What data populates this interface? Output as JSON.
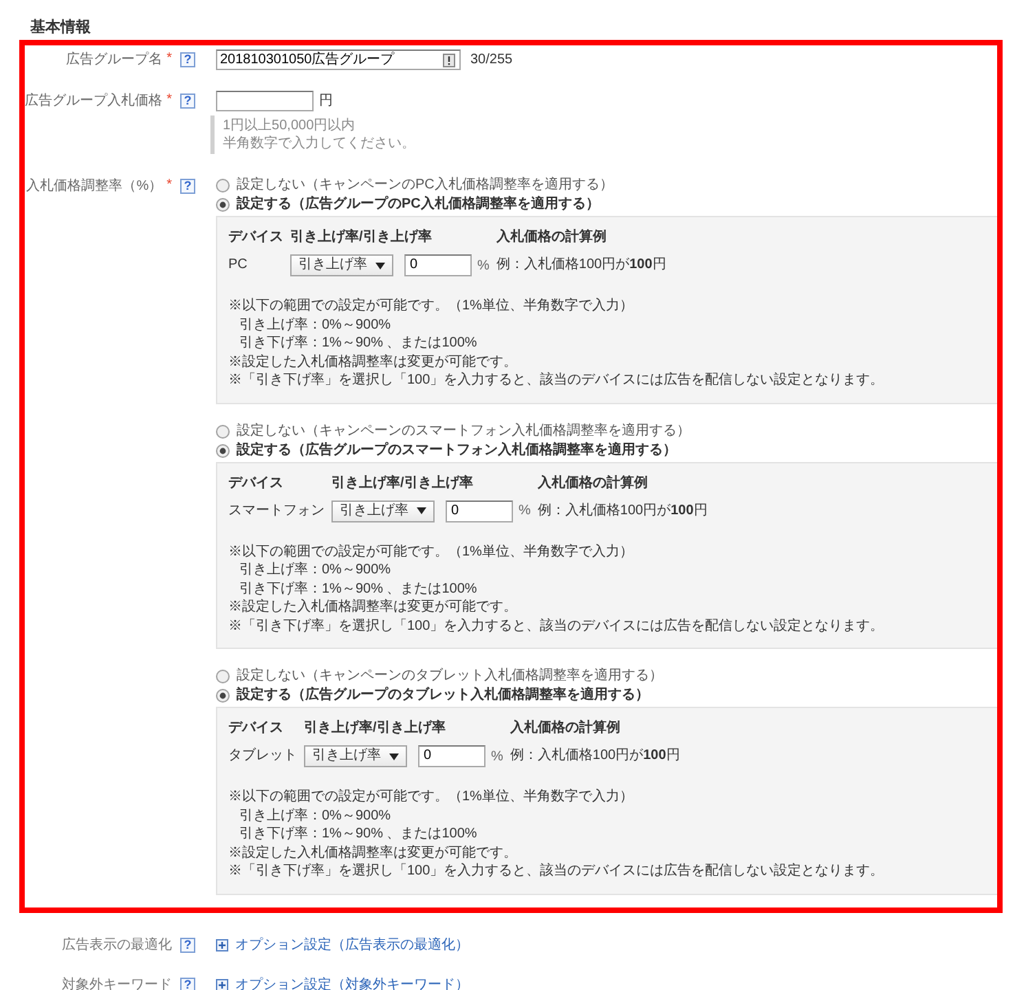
{
  "heading": "基本情報",
  "fields": [
    {
      "kind": "text",
      "highlighted": true,
      "label": "広告グループ名",
      "required_mark": "*",
      "help": "?",
      "value": "201810301050広告グループ",
      "counter": "30/255"
    },
    {
      "kind": "price",
      "highlighted": true,
      "label": "広告グループ入札価格",
      "required_mark": "*",
      "help": "?",
      "unit": "円",
      "hints": [
        "1円以上50,000円以内",
        "半角数字で入力してください。"
      ]
    },
    {
      "kind": "adjustment",
      "highlighted": true,
      "label": "入札価格調整率（%）",
      "required_mark": "*",
      "help": "?",
      "devices": [
        {
          "options": [
            {
              "label": "設定しない（キャンペーンのPC入札価格調整率を適用する）",
              "selected": false
            },
            {
              "label": "設定する（広告グループのPC入札価格調整率を適用する）",
              "selected": true
            }
          ],
          "headers": [
            "デバイス",
            "引き上げ率/引き上げ率",
            "入札価格の計算例"
          ],
          "device": "PC",
          "direction": "引き上げ率",
          "rate": "0",
          "unit": "%",
          "example": "例：入札価格100円が**100**円",
          "notes": [
            {
              "text": "※以下の範囲での設定が可能です。（1%単位、半角数字で入力）",
              "children": [
                {
                  "text": "引き上げ率：0%～900%"
                },
                {
                  "text": "引き下げ率：1%～90% 、または100%"
                }
              ]
            },
            {
              "text": "※設定した入札価格調整率は変更が可能です。"
            },
            {
              "text": "※「引き下げ率」を選択し「100」を入力すると、該当のデバイスには広告を配信しない設定となります。"
            }
          ]
        },
        {
          "options": [
            {
              "label": "設定しない（キャンペーンのスマートフォン入札価格調整率を適用する）",
              "selected": false
            },
            {
              "label": "設定する（広告グループのスマートフォン入札価格調整率を適用する）",
              "selected": true
            }
          ],
          "headers": [
            "デバイス",
            "引き上げ率/引き上げ率",
            "入札価格の計算例"
          ],
          "device": "スマートフォン",
          "direction": "引き上げ率",
          "rate": "0",
          "unit": "%",
          "example": "例：入札価格100円が**100**円",
          "notes": [
            {
              "text": "※以下の範囲での設定が可能です。（1%単位、半角数字で入力）",
              "children": [
                {
                  "text": "引き上げ率：0%～900%"
                },
                {
                  "text": "引き下げ率：1%～90% 、または100%"
                }
              ]
            },
            {
              "text": "※設定した入札価格調整率は変更が可能です。"
            },
            {
              "text": "※「引き下げ率」を選択し「100」を入力すると、該当のデバイスには広告を配信しない設定となります。"
            }
          ]
        },
        {
          "options": [
            {
              "label": "設定しない（キャンペーンのタブレット入札価格調整率を適用する）",
              "selected": false
            },
            {
              "label": "設定する（広告グループのタブレット入札価格調整率を適用する）",
              "selected": true
            }
          ],
          "headers": [
            "デバイス",
            "引き上げ率/引き上げ率",
            "入札価格の計算例"
          ],
          "device": "タブレット",
          "direction": "引き上げ率",
          "rate": "0",
          "unit": "%",
          "example": "例：入札価格100円が**100**円",
          "notes": [
            {
              "text": "※以下の範囲での設定が可能です。（1%単位、半角数字で入力）",
              "children": [
                {
                  "text": "引き上げ率：0%～900%"
                },
                {
                  "text": "引き下げ率：1%～90% 、または100%"
                }
              ]
            },
            {
              "text": "※設定した入札価格調整率は変更が可能です。"
            },
            {
              "text": "※「引き下げ率」を選択し「100」を入力すると、該当のデバイスには広告を配信しない設定となります。"
            }
          ]
        }
      ]
    },
    {
      "kind": "option",
      "highlighted": false,
      "label": "広告表示の最適化",
      "help": "?",
      "link": "オプション設定（広告表示の最適化）"
    },
    {
      "kind": "option",
      "highlighted": false,
      "label": "対象外キーワード",
      "help": "?",
      "link": "オプション設定（対象外キーワード）"
    }
  ]
}
